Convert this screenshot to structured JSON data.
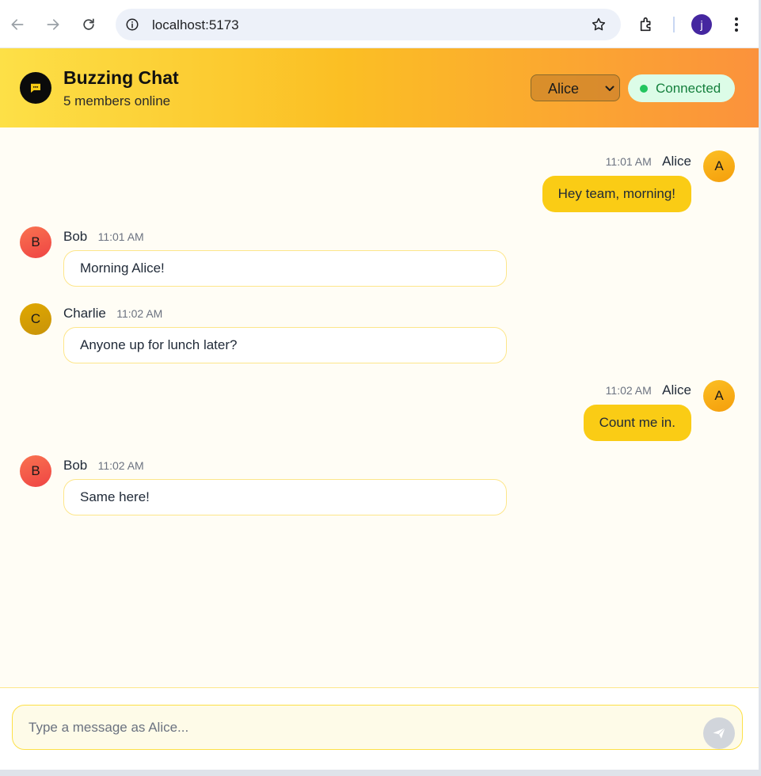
{
  "browser": {
    "url": "localhost:5173",
    "profile_initial": "j"
  },
  "header": {
    "title": "Buzzing Chat",
    "subtitle": "5 members online",
    "user_select": {
      "value": "Alice",
      "options": [
        "Alice"
      ]
    },
    "status": "Connected"
  },
  "messages": [
    {
      "author": "Alice",
      "initial": "A",
      "time": "11:01 AM",
      "text": "Hey team, morning!",
      "mine": true
    },
    {
      "author": "Bob",
      "initial": "B",
      "time": "11:01 AM",
      "text": "Morning Alice!",
      "mine": false
    },
    {
      "author": "Charlie",
      "initial": "C",
      "time": "11:02 AM",
      "text": "Anyone up for lunch later?",
      "mine": false
    },
    {
      "author": "Alice",
      "initial": "A",
      "time": "11:02 AM",
      "text": "Count me in.",
      "mine": true
    },
    {
      "author": "Bob",
      "initial": "B",
      "time": "11:02 AM",
      "text": "Same here!",
      "mine": false
    }
  ],
  "composer": {
    "placeholder": "Type a message as Alice...",
    "value": ""
  },
  "colors": {
    "accent": "#facc15",
    "connected": "#22c55e",
    "avatar_alice": "#f59e0b",
    "avatar_bob": "#f0553a",
    "avatar_charlie": "#d4a00b"
  }
}
